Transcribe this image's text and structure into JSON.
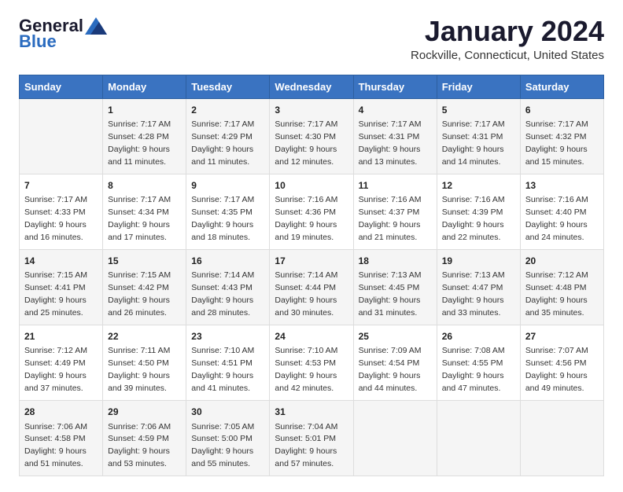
{
  "header": {
    "logo_general": "General",
    "logo_blue": "Blue",
    "month_title": "January 2024",
    "location": "Rockville, Connecticut, United States"
  },
  "weekdays": [
    "Sunday",
    "Monday",
    "Tuesday",
    "Wednesday",
    "Thursday",
    "Friday",
    "Saturday"
  ],
  "weeks": [
    [
      {
        "day": "",
        "sunrise": "",
        "sunset": "",
        "daylight": ""
      },
      {
        "day": "1",
        "sunrise": "Sunrise: 7:17 AM",
        "sunset": "Sunset: 4:28 PM",
        "daylight": "Daylight: 9 hours and 11 minutes."
      },
      {
        "day": "2",
        "sunrise": "Sunrise: 7:17 AM",
        "sunset": "Sunset: 4:29 PM",
        "daylight": "Daylight: 9 hours and 11 minutes."
      },
      {
        "day": "3",
        "sunrise": "Sunrise: 7:17 AM",
        "sunset": "Sunset: 4:30 PM",
        "daylight": "Daylight: 9 hours and 12 minutes."
      },
      {
        "day": "4",
        "sunrise": "Sunrise: 7:17 AM",
        "sunset": "Sunset: 4:31 PM",
        "daylight": "Daylight: 9 hours and 13 minutes."
      },
      {
        "day": "5",
        "sunrise": "Sunrise: 7:17 AM",
        "sunset": "Sunset: 4:31 PM",
        "daylight": "Daylight: 9 hours and 14 minutes."
      },
      {
        "day": "6",
        "sunrise": "Sunrise: 7:17 AM",
        "sunset": "Sunset: 4:32 PM",
        "daylight": "Daylight: 9 hours and 15 minutes."
      }
    ],
    [
      {
        "day": "7",
        "sunrise": "Sunrise: 7:17 AM",
        "sunset": "Sunset: 4:33 PM",
        "daylight": "Daylight: 9 hours and 16 minutes."
      },
      {
        "day": "8",
        "sunrise": "Sunrise: 7:17 AM",
        "sunset": "Sunset: 4:34 PM",
        "daylight": "Daylight: 9 hours and 17 minutes."
      },
      {
        "day": "9",
        "sunrise": "Sunrise: 7:17 AM",
        "sunset": "Sunset: 4:35 PM",
        "daylight": "Daylight: 9 hours and 18 minutes."
      },
      {
        "day": "10",
        "sunrise": "Sunrise: 7:16 AM",
        "sunset": "Sunset: 4:36 PM",
        "daylight": "Daylight: 9 hours and 19 minutes."
      },
      {
        "day": "11",
        "sunrise": "Sunrise: 7:16 AM",
        "sunset": "Sunset: 4:37 PM",
        "daylight": "Daylight: 9 hours and 21 minutes."
      },
      {
        "day": "12",
        "sunrise": "Sunrise: 7:16 AM",
        "sunset": "Sunset: 4:39 PM",
        "daylight": "Daylight: 9 hours and 22 minutes."
      },
      {
        "day": "13",
        "sunrise": "Sunrise: 7:16 AM",
        "sunset": "Sunset: 4:40 PM",
        "daylight": "Daylight: 9 hours and 24 minutes."
      }
    ],
    [
      {
        "day": "14",
        "sunrise": "Sunrise: 7:15 AM",
        "sunset": "Sunset: 4:41 PM",
        "daylight": "Daylight: 9 hours and 25 minutes."
      },
      {
        "day": "15",
        "sunrise": "Sunrise: 7:15 AM",
        "sunset": "Sunset: 4:42 PM",
        "daylight": "Daylight: 9 hours and 26 minutes."
      },
      {
        "day": "16",
        "sunrise": "Sunrise: 7:14 AM",
        "sunset": "Sunset: 4:43 PM",
        "daylight": "Daylight: 9 hours and 28 minutes."
      },
      {
        "day": "17",
        "sunrise": "Sunrise: 7:14 AM",
        "sunset": "Sunset: 4:44 PM",
        "daylight": "Daylight: 9 hours and 30 minutes."
      },
      {
        "day": "18",
        "sunrise": "Sunrise: 7:13 AM",
        "sunset": "Sunset: 4:45 PM",
        "daylight": "Daylight: 9 hours and 31 minutes."
      },
      {
        "day": "19",
        "sunrise": "Sunrise: 7:13 AM",
        "sunset": "Sunset: 4:47 PM",
        "daylight": "Daylight: 9 hours and 33 minutes."
      },
      {
        "day": "20",
        "sunrise": "Sunrise: 7:12 AM",
        "sunset": "Sunset: 4:48 PM",
        "daylight": "Daylight: 9 hours and 35 minutes."
      }
    ],
    [
      {
        "day": "21",
        "sunrise": "Sunrise: 7:12 AM",
        "sunset": "Sunset: 4:49 PM",
        "daylight": "Daylight: 9 hours and 37 minutes."
      },
      {
        "day": "22",
        "sunrise": "Sunrise: 7:11 AM",
        "sunset": "Sunset: 4:50 PM",
        "daylight": "Daylight: 9 hours and 39 minutes."
      },
      {
        "day": "23",
        "sunrise": "Sunrise: 7:10 AM",
        "sunset": "Sunset: 4:51 PM",
        "daylight": "Daylight: 9 hours and 41 minutes."
      },
      {
        "day": "24",
        "sunrise": "Sunrise: 7:10 AM",
        "sunset": "Sunset: 4:53 PM",
        "daylight": "Daylight: 9 hours and 42 minutes."
      },
      {
        "day": "25",
        "sunrise": "Sunrise: 7:09 AM",
        "sunset": "Sunset: 4:54 PM",
        "daylight": "Daylight: 9 hours and 44 minutes."
      },
      {
        "day": "26",
        "sunrise": "Sunrise: 7:08 AM",
        "sunset": "Sunset: 4:55 PM",
        "daylight": "Daylight: 9 hours and 47 minutes."
      },
      {
        "day": "27",
        "sunrise": "Sunrise: 7:07 AM",
        "sunset": "Sunset: 4:56 PM",
        "daylight": "Daylight: 9 hours and 49 minutes."
      }
    ],
    [
      {
        "day": "28",
        "sunrise": "Sunrise: 7:06 AM",
        "sunset": "Sunset: 4:58 PM",
        "daylight": "Daylight: 9 hours and 51 minutes."
      },
      {
        "day": "29",
        "sunrise": "Sunrise: 7:06 AM",
        "sunset": "Sunset: 4:59 PM",
        "daylight": "Daylight: 9 hours and 53 minutes."
      },
      {
        "day": "30",
        "sunrise": "Sunrise: 7:05 AM",
        "sunset": "Sunset: 5:00 PM",
        "daylight": "Daylight: 9 hours and 55 minutes."
      },
      {
        "day": "31",
        "sunrise": "Sunrise: 7:04 AM",
        "sunset": "Sunset: 5:01 PM",
        "daylight": "Daylight: 9 hours and 57 minutes."
      },
      {
        "day": "",
        "sunrise": "",
        "sunset": "",
        "daylight": ""
      },
      {
        "day": "",
        "sunrise": "",
        "sunset": "",
        "daylight": ""
      },
      {
        "day": "",
        "sunrise": "",
        "sunset": "",
        "daylight": ""
      }
    ]
  ]
}
